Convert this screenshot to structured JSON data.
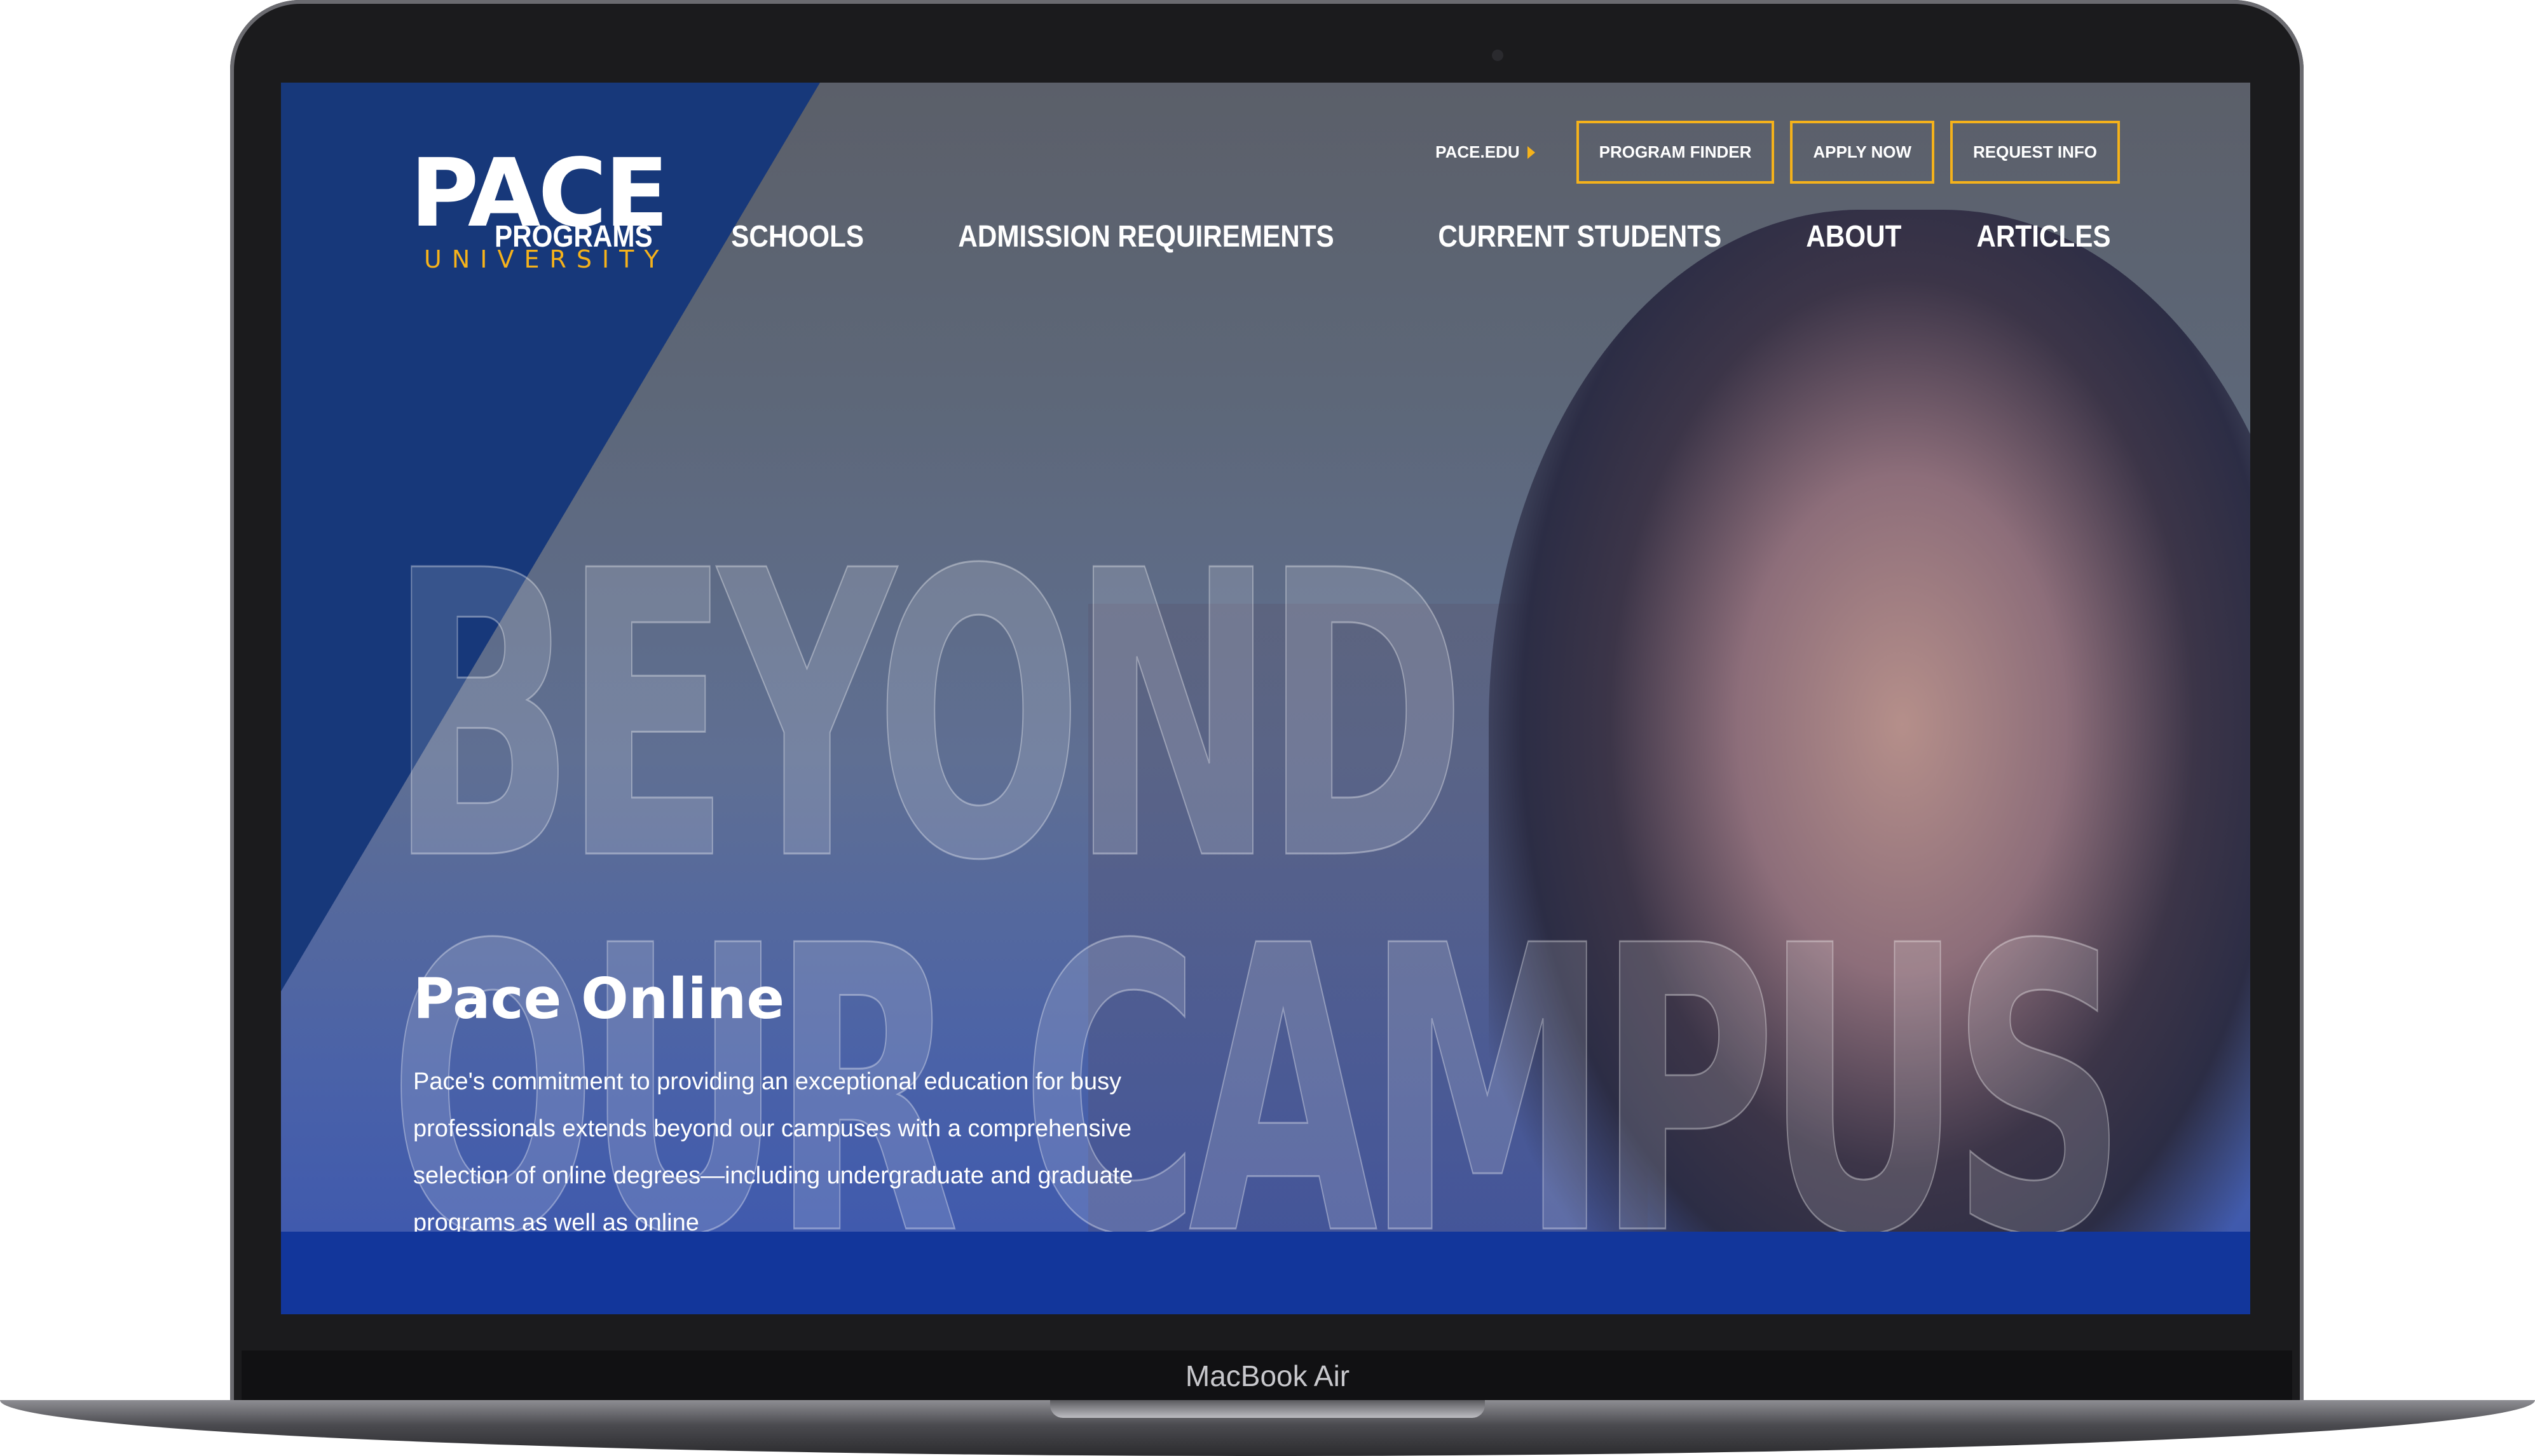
{
  "device": {
    "label": "MacBook Air"
  },
  "logo": {
    "name": "PACE",
    "sub": "UNIVERSITY"
  },
  "utility_nav": {
    "link": "PACE.EDU",
    "buttons": [
      "PROGRAM FINDER",
      "APPLY NOW",
      "REQUEST INFO"
    ]
  },
  "main_nav": [
    "PROGRAMS",
    "SCHOOLS",
    "ADMISSION REQUIREMENTS",
    "CURRENT STUDENTS",
    "ABOUT",
    "ARTICLES"
  ],
  "hero": {
    "background_text": [
      "BEYOND",
      "OUR CAMPUS"
    ],
    "title": "Pace Online",
    "text": "Pace's commitment to providing an exceptional education for busy professionals extends beyond our campuses with a comprehensive selection of online degrees—including undergraduate and graduate programs as well as online"
  },
  "colors": {
    "navy": "#17387a",
    "gold": "#f5b21b",
    "bar": "#12369b"
  }
}
